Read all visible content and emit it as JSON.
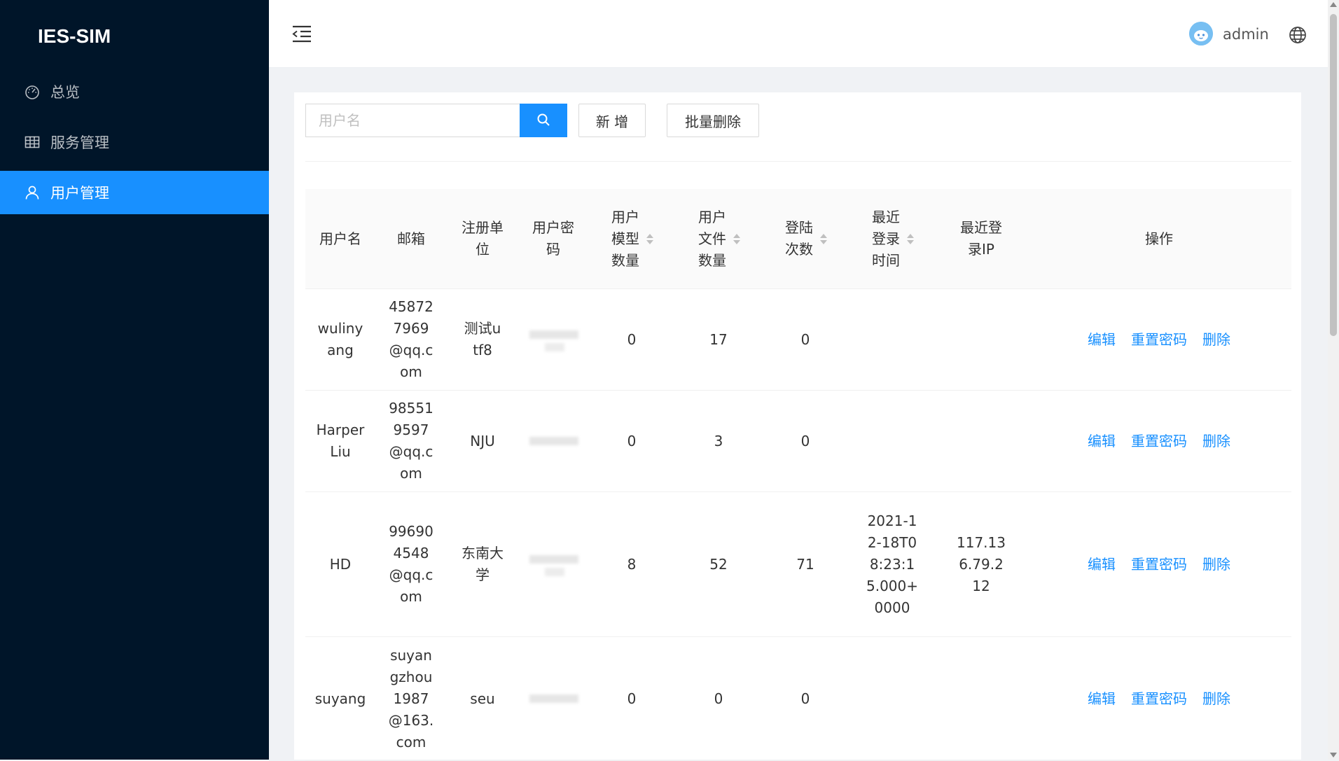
{
  "sidebar": {
    "logo": "IES-SIM",
    "items": [
      {
        "label": "总览",
        "icon": "dashboard-icon"
      },
      {
        "label": "服务管理",
        "icon": "table-icon"
      },
      {
        "label": "用户管理",
        "icon": "user-icon"
      }
    ],
    "active_index": 2
  },
  "header": {
    "username": "admin"
  },
  "toolbar": {
    "search_placeholder": "用户名",
    "add_label": "新 增",
    "batch_delete_label": "批量删除"
  },
  "table": {
    "columns": {
      "username": "用户名",
      "email": "邮箱",
      "org": "注册单位",
      "password": "用户密码",
      "models": "用户模型数量",
      "files": "用户文件数量",
      "logins": "登陆次数",
      "last_time": "最近登录时间",
      "last_ip": "最近登录IP",
      "ops": "操作"
    },
    "actions": {
      "edit": "编辑",
      "reset": "重置密码",
      "delete": "删除"
    },
    "rows": [
      {
        "username": "wulinyang",
        "email": "458727969@qq.com",
        "org": "测试utf8",
        "models": "0",
        "files": "17",
        "logins": "0",
        "last_time": "",
        "last_ip": ""
      },
      {
        "username": "HarperLiu",
        "email": "985519597@qq.com",
        "org": "NJU",
        "models": "0",
        "files": "3",
        "logins": "0",
        "last_time": "",
        "last_ip": ""
      },
      {
        "username": "HD",
        "email": "996904548@qq.com",
        "org": "东南大学",
        "models": "8",
        "files": "52",
        "logins": "71",
        "last_time": "2021-12-18T08:23:15.000+0000",
        "last_ip": "117.136.79.212"
      },
      {
        "username": "suyang",
        "email": "suyangzhou1987@163.com",
        "org": "seu",
        "models": "0",
        "files": "0",
        "logins": "0",
        "last_time": "",
        "last_ip": ""
      }
    ]
  }
}
